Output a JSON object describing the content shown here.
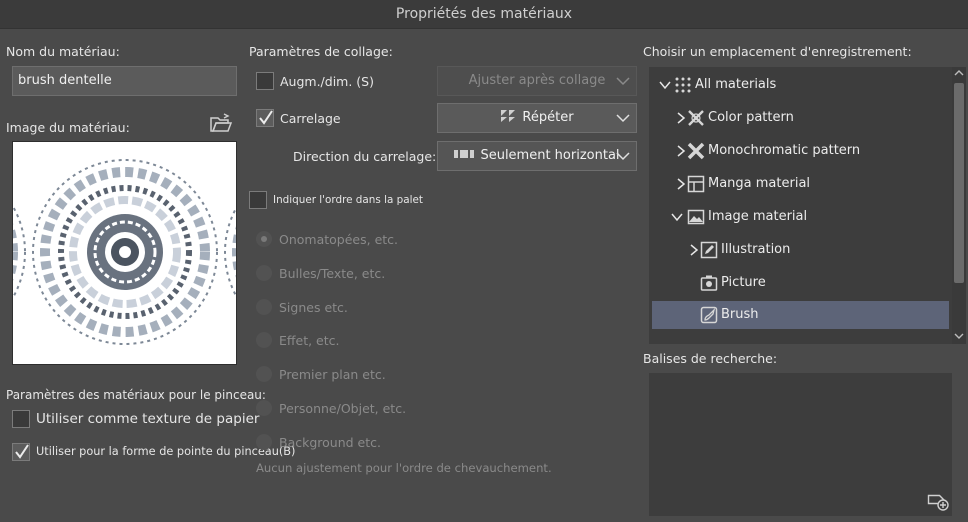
{
  "window": {
    "title": "Propriétés des matériaux"
  },
  "left": {
    "name_label": "Nom du matériau:",
    "name_value": "brush dentelle",
    "image_label": "Image du matériau:",
    "brush_params_label": "Paramètres des matériaux pour le pinceau:",
    "paper_texture_label": "Utiliser comme texture de papier",
    "paper_texture_checked": false,
    "brush_tip_label": "Utiliser pour la forme de pointe du pinceau(B)",
    "brush_tip_checked": true
  },
  "middle": {
    "paste_label": "Paramètres de collage:",
    "resize_label": "Augm./dim. (S)",
    "resize_checked": false,
    "resize_dropdown": "Ajuster après collage",
    "tiling_label": "Carrelage",
    "tiling_checked": true,
    "tiling_dropdown": "Répéter",
    "tiling_direction_label": "Direction du carrelage:",
    "tiling_direction_dropdown": "Seulement horizontal",
    "order_label": "Indiquer l'ordre dans la palette de",
    "order_checked": false,
    "order_options": [
      "Onomatopées, etc.",
      "Bulles/Texte, etc.",
      "Signes etc.",
      "Effet, etc.",
      "Premier plan etc.",
      "Personne/Objet, etc.",
      "Background etc."
    ],
    "order_selected_index": 0,
    "no_adjust_text": "Aucun ajustement pour l'ordre de chevauchement."
  },
  "right": {
    "location_label": "Choisir un emplacement d'enregistrement:",
    "tree": [
      {
        "label": "All materials",
        "icon": "grid-dots-icon",
        "level": 0,
        "expand": "open"
      },
      {
        "label": "Color pattern",
        "icon": "cross-pattern-icon",
        "level": 1,
        "expand": "closed"
      },
      {
        "label": "Monochromatic pattern",
        "icon": "mono-pattern-icon",
        "level": 1,
        "expand": "closed"
      },
      {
        "label": "Manga material",
        "icon": "manga-icon",
        "level": 1,
        "expand": "closed"
      },
      {
        "label": "Image material",
        "icon": "image-icon",
        "level": 1,
        "expand": "open"
      },
      {
        "label": "Illustration",
        "icon": "pencil-icon",
        "level": 2,
        "expand": "closed"
      },
      {
        "label": "Picture",
        "icon": "camera-icon",
        "level": 2,
        "expand": "none"
      },
      {
        "label": "Brush",
        "icon": "brush-icon",
        "level": 2,
        "expand": "none",
        "selected": true
      }
    ],
    "tags_label": "Balises de recherche:"
  },
  "colors": {
    "selection": "#5d6478",
    "background": "#4a4a4a",
    "panel": "#3d3d3d"
  }
}
